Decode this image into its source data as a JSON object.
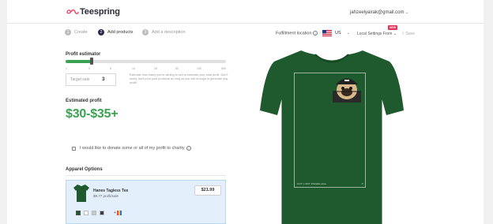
{
  "header": {
    "brand": "Teespring",
    "user_email": "jahzeelyairak@gmail.com",
    "user_caret": "⌄"
  },
  "steps": [
    {
      "num": "1",
      "label": "Create",
      "active": false
    },
    {
      "num": "2",
      "label": "Add products",
      "active": true
    },
    {
      "num": "3",
      "label": "Add a description",
      "active": false
    }
  ],
  "fulfillment": {
    "label": "Fulfillment location",
    "currency": "US",
    "currency_caret": "⌄",
    "new_badge": "NEW",
    "local_settings": "Local Settings From",
    "save": "Save"
  },
  "estimator": {
    "title": "Profit estimator",
    "tick_labels": [
      "1",
      "3",
      "5",
      "10",
      "25",
      "50",
      "100",
      "500"
    ],
    "target_label": "Target sale",
    "target_value": "3",
    "description": "Estimate how many you're aiming to sell to estimate your total profit. Don't worry, we'll print your products as long as you sell enough to generate any profit!"
  },
  "profit": {
    "title": "Estimated profit",
    "range": "$30-$35+"
  },
  "donate": {
    "label": "I would like to donate some or all of my profit to charity"
  },
  "apparel": {
    "title": "Apparel Options",
    "product_name": "Hanes Tagless Tee",
    "profit_per_sale": "$9.77 profit/sale",
    "price": "$21.99",
    "swatches": [
      "#1f5a2e",
      "#ffffff",
      "#c8c8c8",
      "#3d3d3d"
    ],
    "more_label": "+"
  },
  "mockup": {
    "shirt_color": "#1f5a2e",
    "print_area_label": "12.0\" x 16.0\" Printable area"
  },
  "colors": {
    "accent": "#3aa351",
    "brand": "#e8305a"
  }
}
